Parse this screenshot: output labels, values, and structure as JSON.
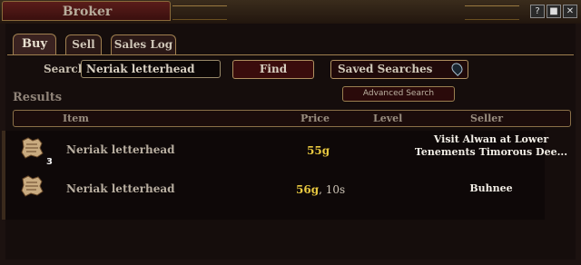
{
  "window": {
    "title": "Broker",
    "controls": [
      {
        "name": "help-icon",
        "glyph": "?"
      },
      {
        "name": "options-icon",
        "glyph": "■"
      },
      {
        "name": "close-icon",
        "glyph": "✕"
      }
    ]
  },
  "tabs": [
    {
      "label": "Buy",
      "active": true
    },
    {
      "label": "Sell",
      "active": false
    },
    {
      "label": "Sales Log",
      "active": false
    }
  ],
  "search": {
    "label": "Search",
    "value": "Neriak letterhead",
    "find_label": "Find",
    "saved_searches_label": "Saved Searches",
    "advanced_label": "Advanced Search"
  },
  "results": {
    "label": "Results",
    "columns": [
      "Item",
      "Price",
      "Level",
      "Seller"
    ],
    "rows": [
      {
        "icon": "parchment-icon",
        "quantity": "3",
        "item": "Neriak letterhead",
        "price_gold": "55g",
        "price_rest": "",
        "level": "",
        "seller_line1": "Visit Alwan at Lower",
        "seller_line2": "Tenements Timorous Dee..."
      },
      {
        "icon": "parchment-icon",
        "quantity": "",
        "item": "Neriak letterhead",
        "price_gold": "56g",
        "price_rest": ", 10s",
        "level": "",
        "seller_line1": "Buhnee",
        "seller_line2": ""
      }
    ]
  },
  "colors": {
    "gold": "#e8c840",
    "accent_border": "#a08050",
    "button_red": "#3a0c0c"
  }
}
